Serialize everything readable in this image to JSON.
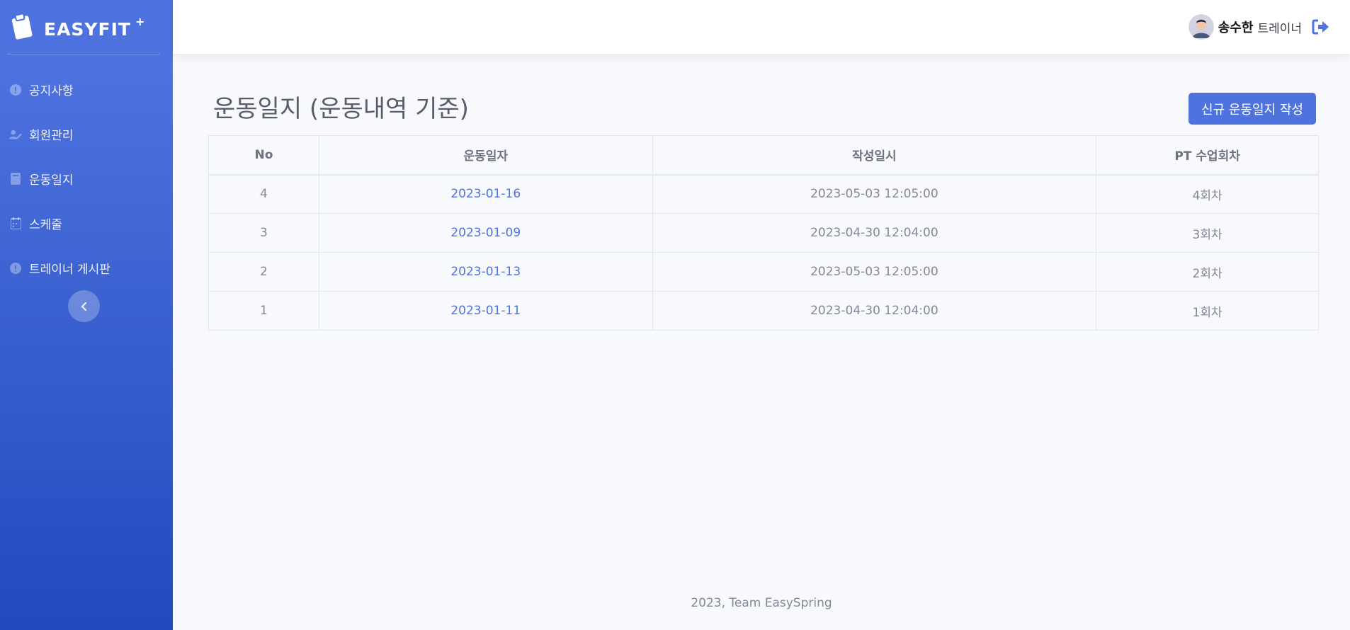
{
  "brand": {
    "name": "EASYFIT",
    "sup": "+"
  },
  "sidebar": {
    "items": [
      {
        "label": "공지사항",
        "icon": "alert-circle-icon"
      },
      {
        "label": "회원관리",
        "icon": "user-edit-icon"
      },
      {
        "label": "운동일지",
        "icon": "book-icon"
      },
      {
        "label": "스케줄",
        "icon": "calendar-icon"
      },
      {
        "label": "트레이너 게시판",
        "icon": "alert-circle-icon"
      }
    ],
    "toggle_icon": "chevron-left-icon"
  },
  "topbar": {
    "user_name": "송수한",
    "user_role": "트레이너",
    "logout_icon": "sign-out-icon"
  },
  "main": {
    "title": "운동일지 (운동내역 기준)",
    "new_button_label": "신규 운동일지 작성",
    "table": {
      "headers": [
        "No",
        "운동일자",
        "작성일시",
        "PT 수업회차"
      ],
      "rows": [
        {
          "no": "4",
          "date": "2023-01-16",
          "created": "2023-05-03 12:05:00",
          "session": "4회차"
        },
        {
          "no": "3",
          "date": "2023-01-09",
          "created": "2023-04-30 12:04:00",
          "session": "3회차"
        },
        {
          "no": "2",
          "date": "2023-01-13",
          "created": "2023-05-03 12:05:00",
          "session": "2회차"
        },
        {
          "no": "1",
          "date": "2023-01-11",
          "created": "2023-04-30 12:04:00",
          "session": "1회차"
        }
      ]
    }
  },
  "footer": {
    "text": "2023, Team EasySpring"
  },
  "colors": {
    "primary": "#4e73df",
    "primary_dark": "#224abe",
    "text": "#858796"
  }
}
